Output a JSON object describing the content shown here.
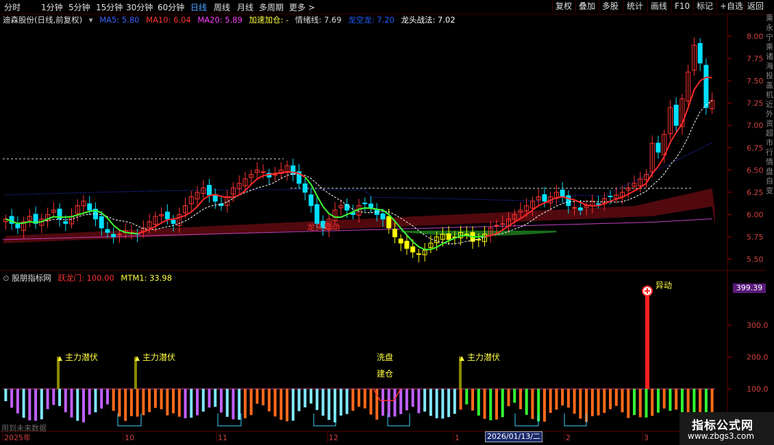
{
  "toolbar": {
    "periods": [
      "分时",
      "1分钟",
      "5分钟",
      "15分钟",
      "30分钟",
      "60分钟",
      "日线",
      "周线",
      "月线",
      "多周期",
      "更多"
    ],
    "active_period": "日线",
    "right_buttons": [
      "复权",
      "叠加",
      "多股",
      "统计",
      "画线",
      "F10",
      "标记",
      "+自选",
      "返回"
    ]
  },
  "main": {
    "title": "迪森股份(日线,前复权)",
    "ma5_label": "MA5: 5.80",
    "ma10_label": "MA10: 6.04",
    "ma20_label": "MA20: 5.89",
    "accel_label": "加速加仓: -",
    "emotion_label": "情绪线: 7.69",
    "dragon_label": "龙空龙: 7.20",
    "tactic_label": "龙头战法: 7.02",
    "annotation": "龙头异动",
    "yticks": [
      "8.00",
      "7.75",
      "7.50",
      "7.25",
      "7.00",
      "6.75",
      "6.50",
      "6.25",
      "6.00",
      "5.75",
      "5.50"
    ]
  },
  "sub": {
    "title": "股朋指标网",
    "yl_label": "跃龙门: 100.00",
    "mtm_label": "MTM1: 33.98",
    "yticks": [
      "300.0",
      "200.0",
      "100.0"
    ],
    "current_value": "399.39",
    "signal_labels": [
      "主力潜伏",
      "主力潜伏",
      "洗盘",
      "建仓",
      "主力潜伏",
      "异动"
    ]
  },
  "timeline": {
    "labels": [
      "2025年",
      "10",
      "11",
      "12",
      "1",
      "2",
      "3"
    ],
    "cursor_date": "2026/01/13/二"
  },
  "history_note": "用到未来数据",
  "watermark": {
    "line1": "指标公式网",
    "line2": "www.zbgs3.com"
  },
  "sidebar_text": "乘永宁乘诸海投盖机近外资超市行情盘自变",
  "colors": {
    "up": "#ff3333",
    "down": "#00e0ff",
    "ma5": "#ffffff",
    "ma10": "#ff2a2a",
    "ma20": "#ff40ff",
    "yellow": "#ffff00",
    "green": "#33ff33",
    "orange": "#ff6a1a",
    "purple": "#c060ff",
    "cyan": "#80e8ff"
  },
  "chart_data": {
    "type": "candlestick",
    "ylim": [
      5.45,
      8.1
    ],
    "closes": [
      5.95,
      5.9,
      5.85,
      5.92,
      5.98,
      5.9,
      5.95,
      6.0,
      6.05,
      5.95,
      5.9,
      5.98,
      6.1,
      6.15,
      6.05,
      5.95,
      5.85,
      5.8,
      5.75,
      5.78,
      5.82,
      5.8,
      5.78,
      5.85,
      5.92,
      5.98,
      6.0,
      5.95,
      5.9,
      6.0,
      6.1,
      6.2,
      6.25,
      6.3,
      6.22,
      6.15,
      6.1,
      6.2,
      6.3,
      6.35,
      6.4,
      6.45,
      6.5,
      6.48,
      6.42,
      6.45,
      6.5,
      6.55,
      6.45,
      6.35,
      6.25,
      6.1,
      5.9,
      5.85,
      5.95,
      6.05,
      6.1,
      6.05,
      6.0,
      6.1,
      6.12,
      6.08,
      6.0,
      5.95,
      5.85,
      5.75,
      5.68,
      5.62,
      5.58,
      5.56,
      5.6,
      5.68,
      5.75,
      5.78,
      5.72,
      5.75,
      5.8,
      5.78,
      5.7,
      5.72,
      5.78,
      5.85,
      5.88,
      5.9,
      5.95,
      6.0,
      6.05,
      6.1,
      6.15,
      6.2,
      6.15,
      6.2,
      6.25,
      6.2,
      6.1,
      6.08,
      6.05,
      6.1,
      6.15,
      6.12,
      6.18,
      6.2,
      6.22,
      6.25,
      6.3,
      6.35,
      6.4,
      6.45,
      6.8,
      6.7,
      6.9,
      7.2,
      7.0,
      7.3,
      7.6,
      7.9,
      7.7,
      7.2,
      7.28
    ]
  }
}
